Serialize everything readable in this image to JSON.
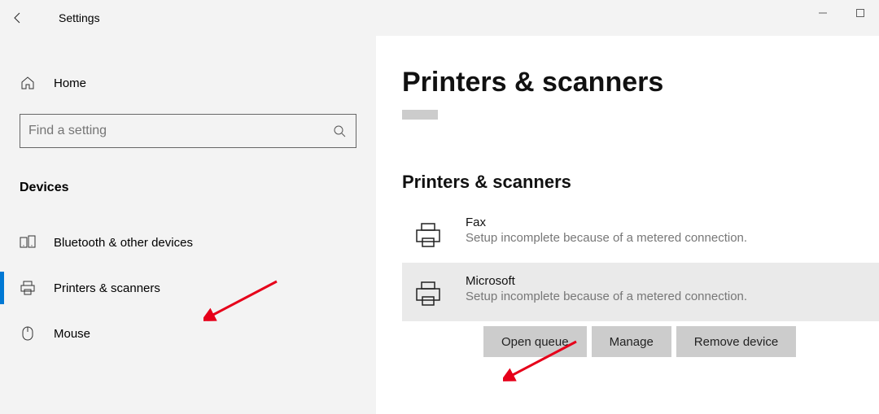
{
  "titlebar": {
    "title": "Settings"
  },
  "sidebar": {
    "home_label": "Home",
    "search_placeholder": "Find a setting",
    "category": "Devices",
    "items": [
      {
        "label": "Bluetooth & other devices",
        "icon": "bluetooth-devices"
      },
      {
        "label": "Printers & scanners",
        "icon": "printer",
        "active": true
      },
      {
        "label": "Mouse",
        "icon": "mouse"
      }
    ]
  },
  "main": {
    "page_title": "Printers & scanners",
    "section_title": "Printers & scanners",
    "printers": [
      {
        "name": "Fax",
        "status": "Setup incomplete because of a metered connection.",
        "selected": false
      },
      {
        "name": "Microsoft",
        "status": "Setup incomplete because of a metered connection.",
        "selected": true
      }
    ],
    "actions": {
      "open_queue": "Open queue",
      "manage": "Manage",
      "remove": "Remove device"
    }
  },
  "annotations": {
    "arrow1_target": "sidebar-item-printers",
    "arrow2_target": "open-queue-button"
  }
}
